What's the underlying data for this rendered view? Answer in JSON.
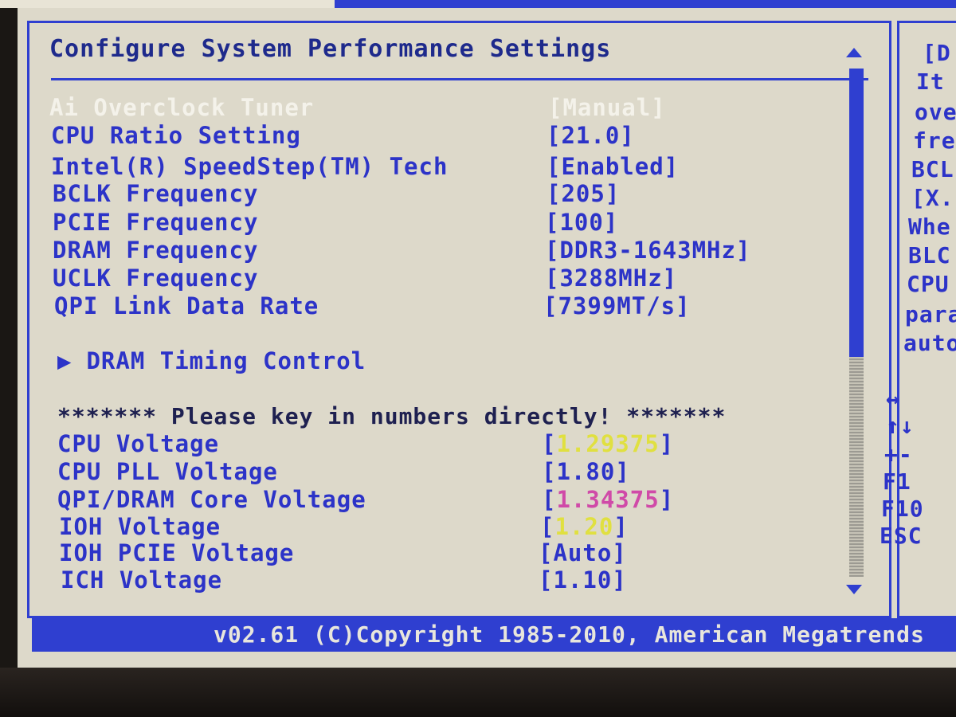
{
  "header": {
    "title": "Configure System Performance Settings"
  },
  "settings": [
    {
      "label": "Ai Overclock Tuner",
      "value": "[Manual]",
      "selected": true
    },
    {
      "label": "CPU Ratio Setting",
      "value": "[21.0]"
    },
    {
      "label": "Intel(R) SpeedStep(TM) Tech",
      "value": "[Enabled]"
    },
    {
      "label": "BCLK Frequency",
      "value": "[205]"
    },
    {
      "label": "PCIE Frequency",
      "value": "[100]"
    },
    {
      "label": "DRAM Frequency",
      "value": "[DDR3-1643MHz]"
    },
    {
      "label": "UCLK Frequency",
      "value": "[3288MHz]"
    },
    {
      "label": "QPI Link Data Rate",
      "value": "[7399MT/s]"
    }
  ],
  "submenu": {
    "label": "DRAM Timing Control"
  },
  "banner": "******* Please key in numbers directly! *******",
  "voltages": [
    {
      "label": "CPU Voltage",
      "value": "1.29375",
      "color": "yellow"
    },
    {
      "label": "CPU PLL Voltage",
      "value": "1.80",
      "color": "default"
    },
    {
      "label": "QPI/DRAM Core Voltage",
      "value": "1.34375",
      "color": "pink"
    },
    {
      "label": "IOH Voltage",
      "value": "1.20",
      "color": "yellow"
    },
    {
      "label": "IOH PCIE Voltage",
      "value": "Auto",
      "color": "default"
    },
    {
      "label": "ICH Voltage",
      "value": "1.10",
      "color": "default"
    }
  ],
  "help": {
    "lines": [
      "[D",
      "It",
      "ove",
      "fre",
      "BCL",
      "[X.",
      "Whe",
      "BLC",
      "CPU",
      "para",
      "auto"
    ],
    "keys": [
      "↔",
      "↑↓",
      "+-",
      "F1",
      "F10",
      "ESC"
    ]
  },
  "footer": {
    "text": "v02.61 (C)Copyright 1985-2010, American Megatrends"
  },
  "colors": {
    "panel_bg": "#ddd9ca",
    "accent_blue": "#2f3fd0",
    "text_blue": "#2c33c8",
    "selected_text": "#f4f2ea",
    "value_yellow": "#e0e040",
    "value_pink": "#d04aa8"
  }
}
